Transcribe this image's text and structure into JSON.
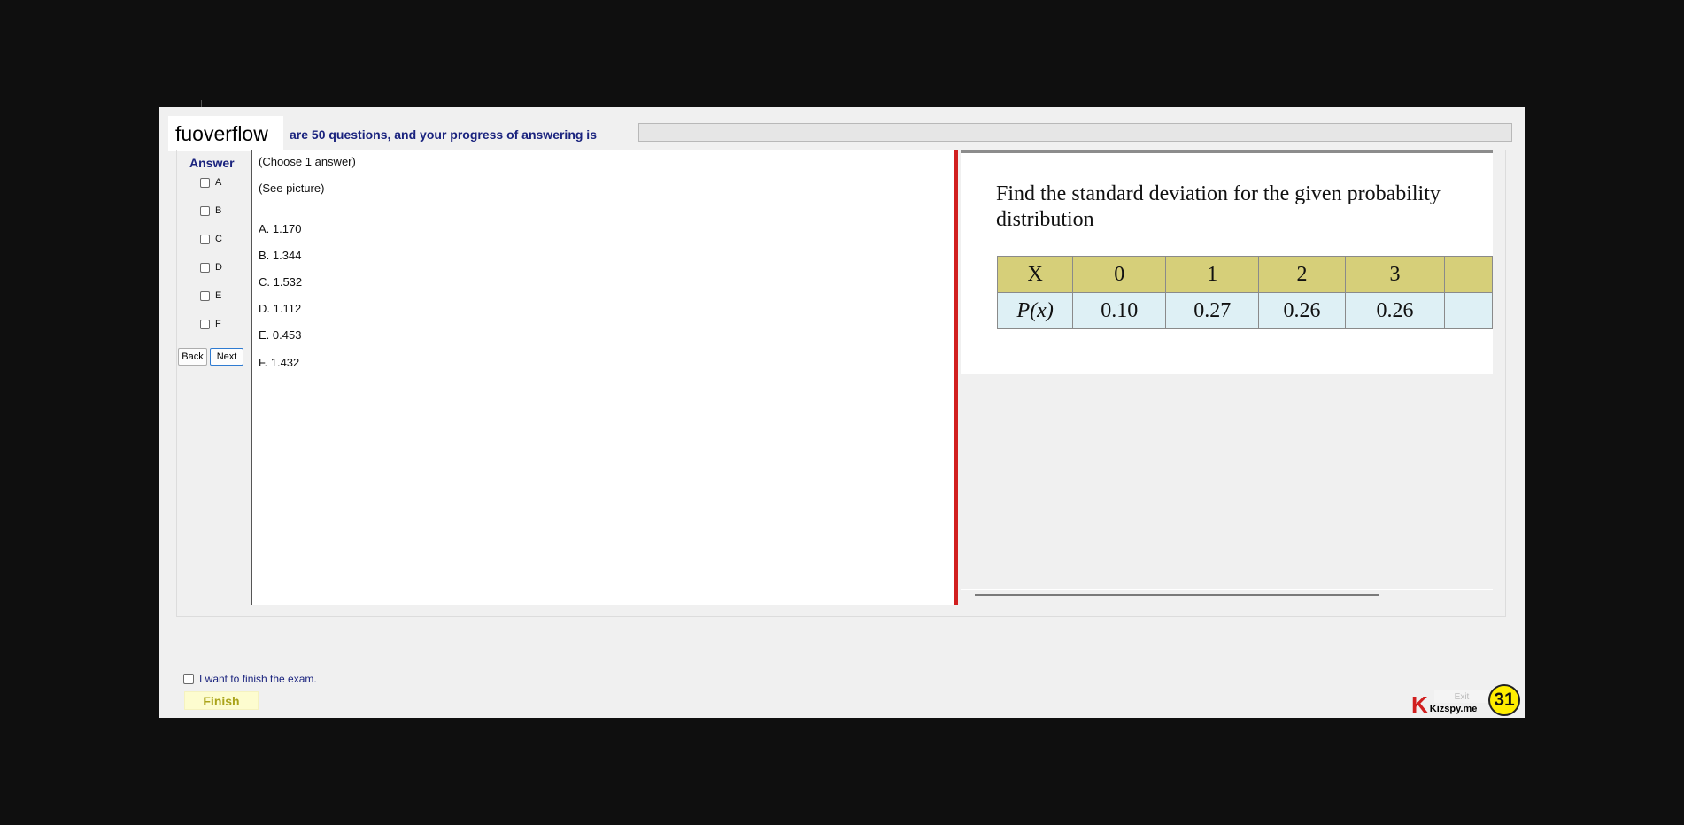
{
  "header": {
    "logo_text": "fuoverflow",
    "progress_text": "are 50 questions, and your progress of answering is",
    "progress_fraction": 0
  },
  "answer_panel": {
    "title": "Answer",
    "options": [
      "A",
      "B",
      "C",
      "D",
      "E",
      "F"
    ],
    "back_label": "Back",
    "next_label": "Next"
  },
  "question": {
    "instruction": "(Choose 1 answer)",
    "prompt": "(See picture)",
    "choices": [
      "A.  1.170",
      "B.  1.344",
      "C.  1.532",
      "D.  1.112",
      "E.  0.453",
      "F.  1.432"
    ]
  },
  "picture": {
    "title": "Find the standard deviation for the given probability distribution",
    "table": {
      "header_label": "X",
      "row_label_italic": "P(x)",
      "x_values": [
        "0",
        "1",
        "2",
        "3",
        ""
      ],
      "p_values": [
        "0.10",
        "0.27",
        "0.26",
        "0.26",
        ""
      ]
    }
  },
  "footer": {
    "finish_check_label": "I want to finish the exam.",
    "finish_label": "Finish",
    "exit_label": "Exit",
    "brand_letter": "K",
    "brand_text": "Kizspy.me",
    "badge_number": "31"
  },
  "colors": {
    "accent_navy": "#1a237e",
    "divider_red": "#d11f1f",
    "table_header": "#d6cf79",
    "table_body": "#def0f5",
    "finish_bg": "#fdfccf",
    "badge": "#ffee00"
  }
}
